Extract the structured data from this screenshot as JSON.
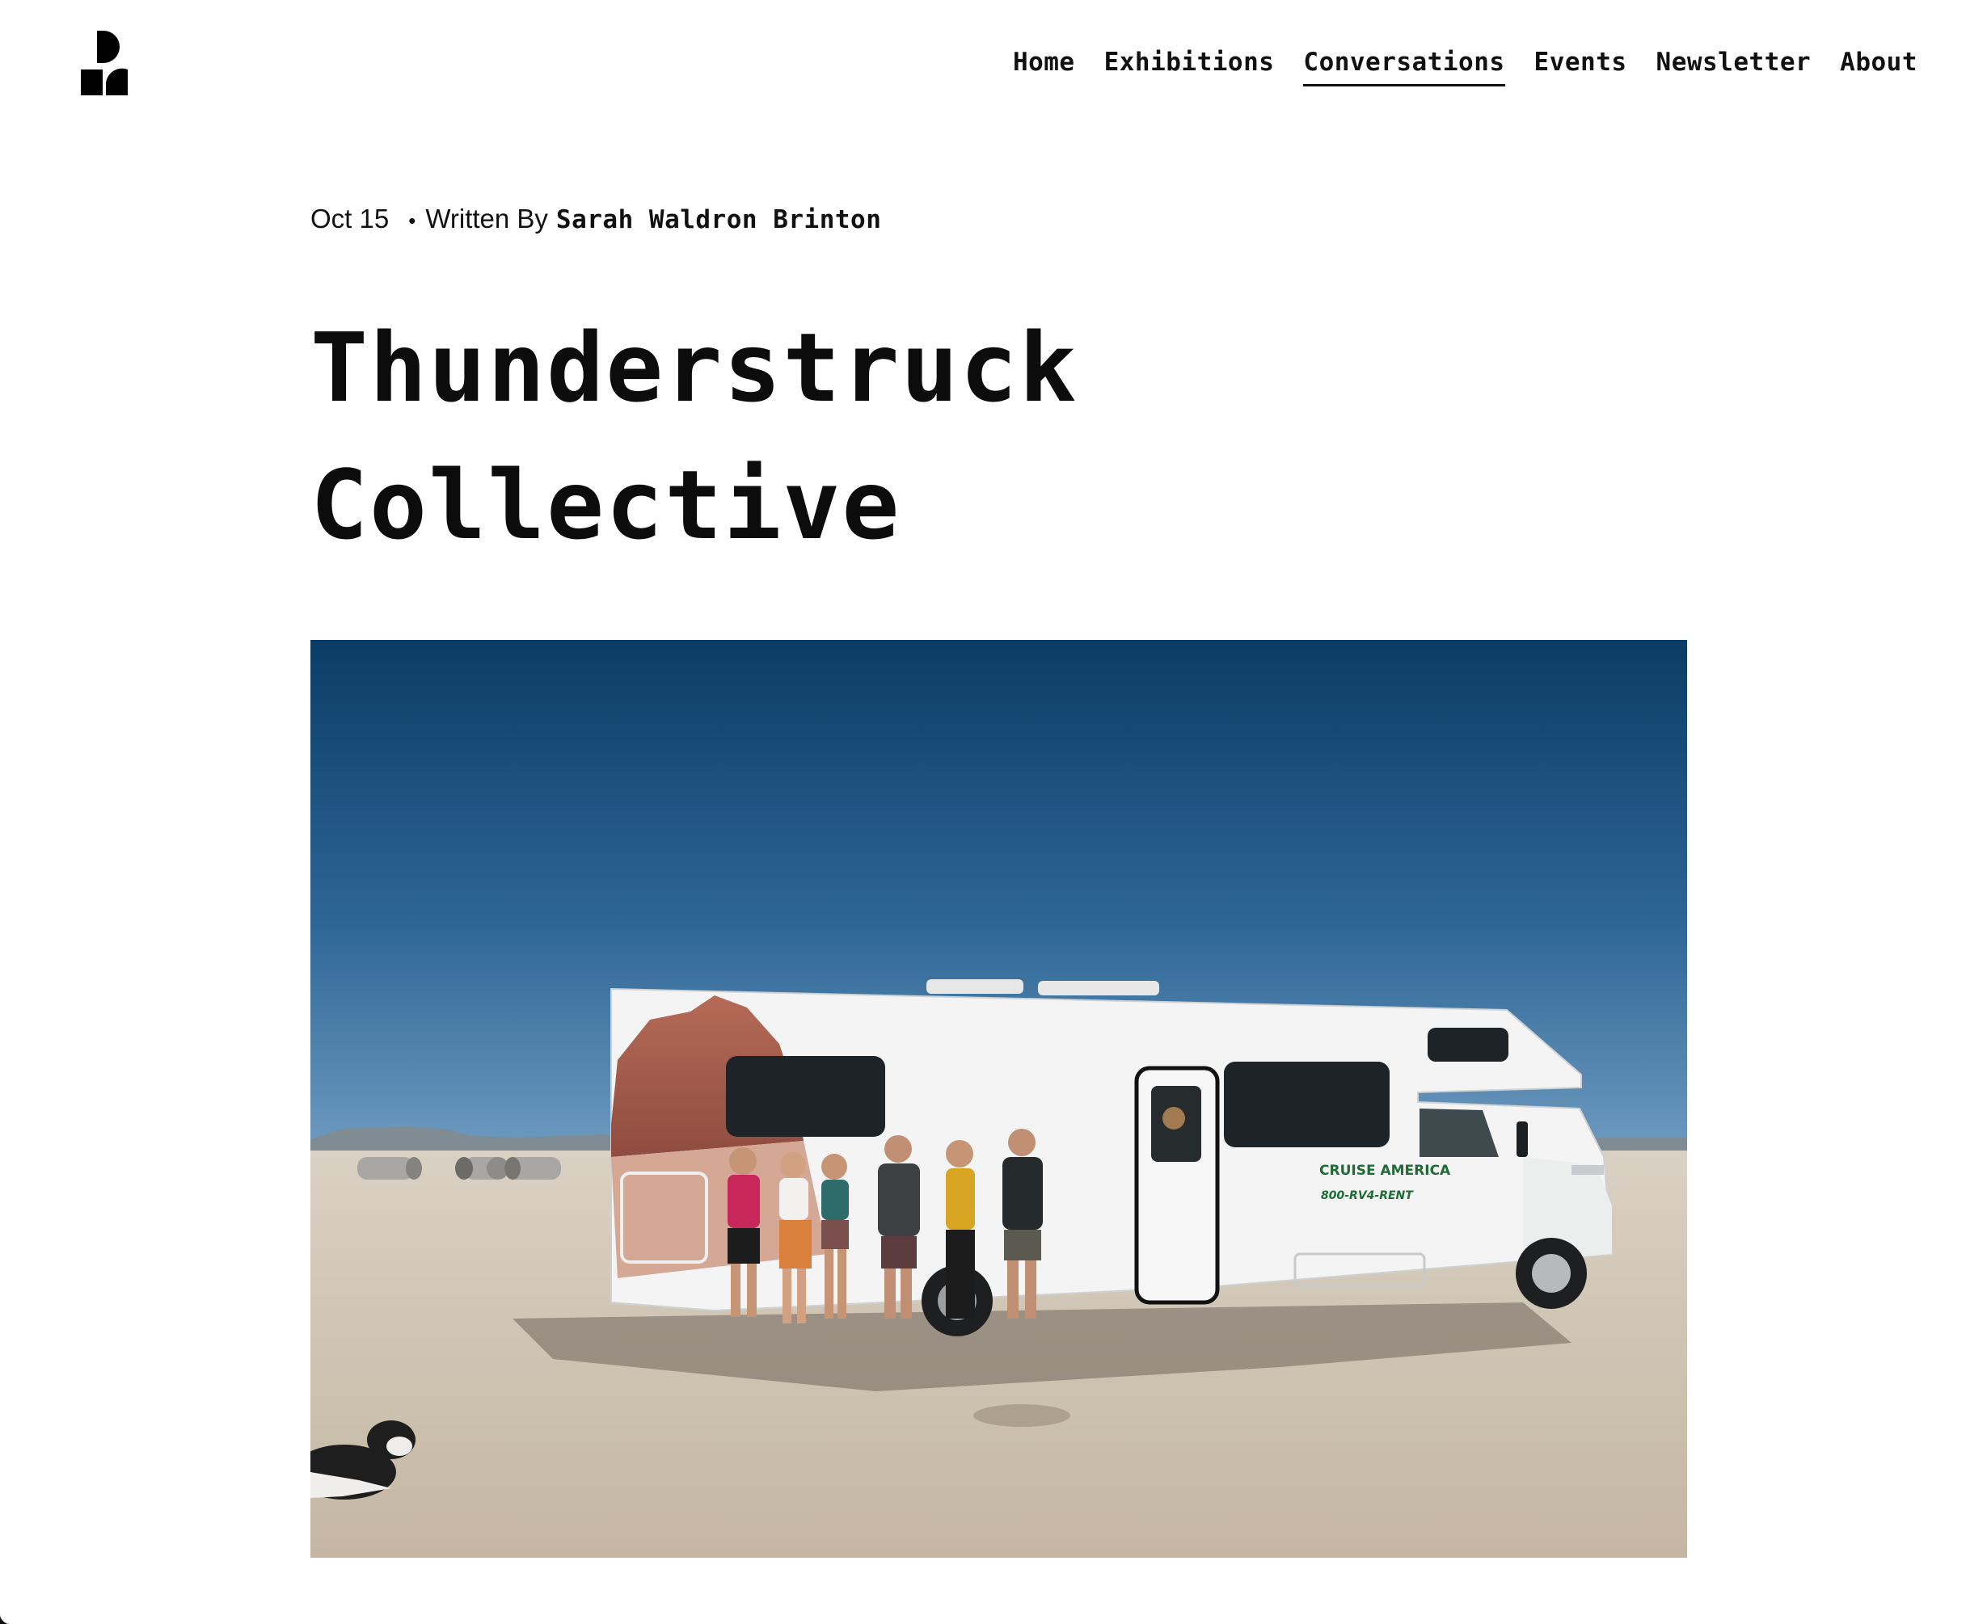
{
  "header": {
    "logo_name": "site-logo",
    "nav": [
      {
        "label": "Home",
        "active": false
      },
      {
        "label": "Exhibitions",
        "active": false
      },
      {
        "label": "Conversations",
        "active": true
      },
      {
        "label": "Events",
        "active": false
      },
      {
        "label": "Newsletter",
        "active": false
      },
      {
        "label": "About",
        "active": false
      }
    ]
  },
  "article": {
    "date": "Oct 15",
    "separator": "•",
    "written_by_label": "Written By",
    "author": "Sarah Waldron Brinton",
    "title_lines": [
      "Thunderstruck",
      "Collective"
    ],
    "hero_image": {
      "subject": "group-photo-rv-desert",
      "rv_logo_text": "CRUISE AMERICA",
      "rv_phone_text": "800-RV4-RENT",
      "colors": {
        "sky_top": "#0d3d66",
        "sky_bottom": "#5d8fb8",
        "ground": "#cfc3b2",
        "rv_body": "#f3f4f3",
        "rock": "#a9604f"
      }
    }
  }
}
